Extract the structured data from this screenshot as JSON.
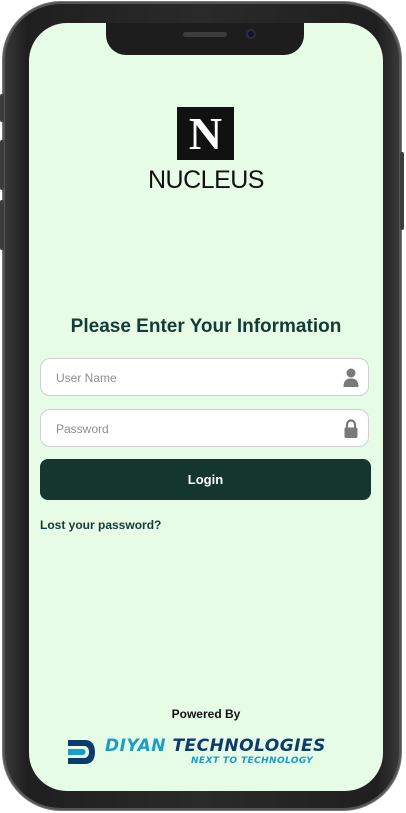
{
  "brand": {
    "logo_letter": "N",
    "name": "NUCLEUS"
  },
  "login_form": {
    "heading": "Please Enter Your Information",
    "username": {
      "placeholder": "User Name",
      "value": "",
      "icon": "user-icon"
    },
    "password": {
      "placeholder": "Password",
      "value": "",
      "icon": "lock-icon"
    },
    "login_label": "Login",
    "forgot_label": "Lost your password?"
  },
  "footer": {
    "powered_by": "Powered By",
    "company_part1": "DIYAN",
    "company_part2": "TECHNOLOGIES",
    "tagline": "NEXT TO TECHNOLOGY"
  },
  "colors": {
    "screen_bg": "#e6fce6",
    "primary": "#14362f",
    "heading": "#153b36",
    "company_light": "#1aa0c8",
    "company_dark": "#0d3b6b"
  }
}
